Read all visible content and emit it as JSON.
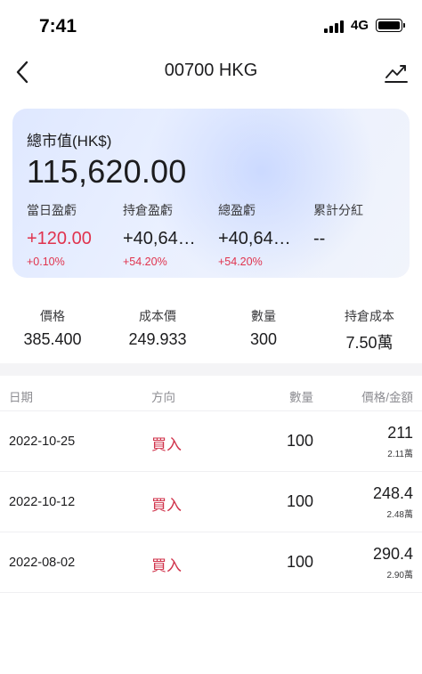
{
  "status": {
    "time": "7:41",
    "network": "4G"
  },
  "nav": {
    "title": "00700 HKG"
  },
  "summary": {
    "market_value_label": "總市值(HK$)",
    "market_value": "115,620.00",
    "columns": [
      {
        "label": "當日盈虧",
        "value": "+120.00",
        "pct": "+0.10%"
      },
      {
        "label": "持倉盈虧",
        "value": "+40,64…",
        "pct": "+54.20%"
      },
      {
        "label": "總盈虧",
        "value": "+40,64…",
        "pct": "+54.20%"
      },
      {
        "label": "累計分紅",
        "value": "--",
        "pct": ""
      }
    ]
  },
  "stats": [
    {
      "label": "價格",
      "value": "385.400"
    },
    {
      "label": "成本價",
      "value": "249.933"
    },
    {
      "label": "數量",
      "value": "300"
    },
    {
      "label": "持倉成本",
      "value": "7.50萬"
    }
  ],
  "table": {
    "headers": {
      "date": "日期",
      "direction": "方向",
      "quantity": "數量",
      "price_amount": "價格/金額"
    },
    "rows": [
      {
        "date": "2022-10-25",
        "direction": "買入",
        "quantity": "100",
        "price": "211",
        "amount": "2.11萬"
      },
      {
        "date": "2022-10-12",
        "direction": "買入",
        "quantity": "100",
        "price": "248.4",
        "amount": "2.48萬"
      },
      {
        "date": "2022-08-02",
        "direction": "買入",
        "quantity": "100",
        "price": "290.4",
        "amount": "2.90萬"
      }
    ]
  },
  "colors": {
    "positive": "#e0334e",
    "card_gradient": "#dfe8ff",
    "muted": "#8e8e93"
  },
  "icons": {
    "back": "chevron-left-icon",
    "chart": "trend-chart-icon"
  }
}
